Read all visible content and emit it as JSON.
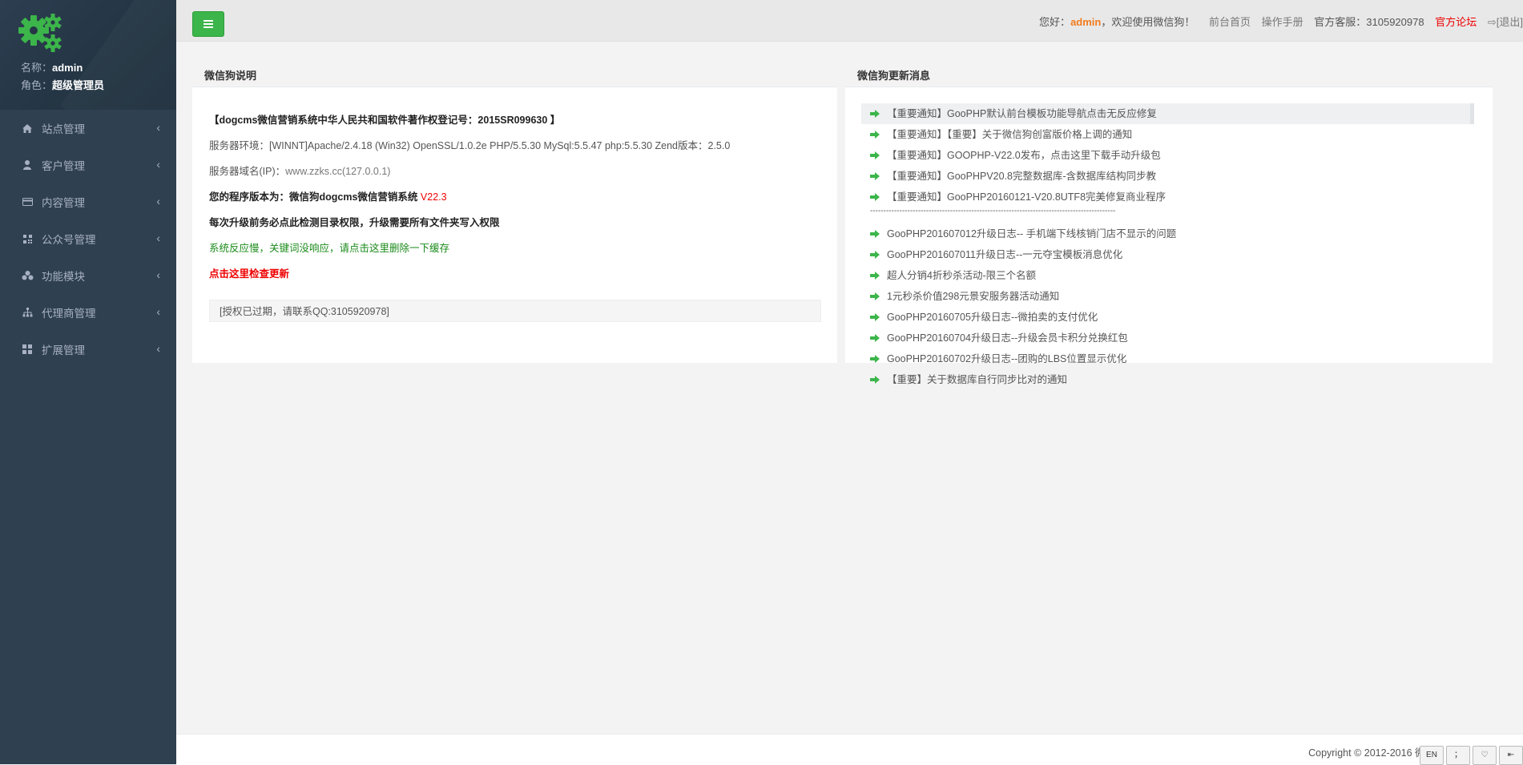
{
  "sidebar": {
    "profile": {
      "name_label": "名称：",
      "name_value": "admin",
      "role_label": "角色：",
      "role_value": "超级管理员"
    },
    "items": [
      {
        "label": "站点管理",
        "icon": "home-icon"
      },
      {
        "label": "客户管理",
        "icon": "user-icon"
      },
      {
        "label": "内容管理",
        "icon": "card-icon"
      },
      {
        "label": "公众号管理",
        "icon": "qrcode-icon"
      },
      {
        "label": "功能模块",
        "icon": "cubes-icon"
      },
      {
        "label": "代理商管理",
        "icon": "sitemap-icon"
      },
      {
        "label": "扩展管理",
        "icon": "grid-icon"
      }
    ]
  },
  "topbar": {
    "greeting": "您好：",
    "user": "admin",
    "welcome": "，欢迎使用微信狗！",
    "home_link": "前台首页",
    "manual_link": "操作手册",
    "service": "官方客服：3105920978",
    "forum_link": "官方论坛",
    "logout": "[退出]"
  },
  "left_panel": {
    "title": "微信狗说明",
    "copyright_reg": "【dogcms微信营销系统中华人民共和国软件著作权登记号：2015SR099630 】",
    "server_env": "服务器环境：[WINNT]Apache/2.4.18 (Win32) OpenSSL/1.0.2e PHP/5.5.30 MySql:5.5.47 php:5.5.30   Zend版本：2.5.0",
    "server_domain_label": "服务器域名(IP)：",
    "server_domain": "www.zzks.cc(127.0.0.1)",
    "version_label": "您的程序版本为：微信狗dogcms微信营销系统 ",
    "version": "V22.3",
    "upgrade_tip": "每次升级前务必点此检测目录权限，升级需要所有文件夹写入权限",
    "cache_tip": "系统反应慢，关键词没响应，请点击这里删除一下缓存",
    "check_update": "点击这里检查更新",
    "license_notice": "[授权已过期，请联系QQ:3105920978]"
  },
  "right_panel": {
    "title": "微信狗更新消息",
    "news_top": [
      "【重要通知】GooPHP默认前台模板功能导航点击无反应修复",
      "【重要通知】【重要】关于微信狗创富版价格上调的通知",
      "【重要通知】GOOPHP-V22.0发布，点击这里下载手动升级包",
      "【重要通知】GooPHPV20.8完整数据库-含数据库结构同步教",
      "【重要通知】GooPHP20160121-V20.8UTF8完美修复商业程序"
    ],
    "separator": "--------------------------------------------------------------------------------------------",
    "news_bottom": [
      "GooPHP201607012升级日志-- 手机端下线核销门店不显示的问题",
      "GooPHP201607011升级日志--一元夺宝模板消息优化",
      "超人分销4折秒杀活动-限三个名额",
      "1元秒杀价值298元景安服务器活动通知",
      "GooPHP20160705升级日志--微拍卖的支付优化",
      "GooPHP20160704升级日志--升级会员卡积分兑换红包",
      "GooPHP20160702升级日志--团购的LBS位置显示优化",
      "【重要】关于数据库自行同步比对的通知"
    ]
  },
  "footer": {
    "copyright": "Copyright © 2012-2016 微信",
    "tools": [
      "EN",
      "；",
      "♡",
      "⇤"
    ]
  },
  "colors": {
    "sidebar_bg": "#2f4050",
    "menu_button": "#3cb54a",
    "user_highlight": "#f37b1d",
    "forum_link": "#e00000",
    "arrow_green": "#3cb54a"
  }
}
